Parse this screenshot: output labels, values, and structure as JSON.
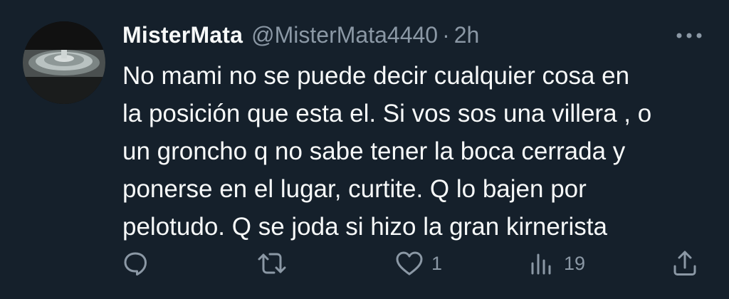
{
  "tweet": {
    "author": {
      "display_name": "MisterMata",
      "handle": "@MisterMata4440",
      "separator": "·",
      "time": "2h"
    },
    "text_lines": [
      "No mami  no se puede decir cualquier cosa en",
      "la posición que esta el. Si vos sos una villera , o",
      "un groncho q no sabe tener la boca cerrada y",
      "ponerse en el lugar, curtite. Q lo bajen por",
      "pelotudo. Q se joda si hizo la gran kirnerista"
    ],
    "actions": {
      "reply": {
        "icon": "reply-icon",
        "count": ""
      },
      "retweet": {
        "icon": "retweet-icon",
        "count": ""
      },
      "like": {
        "icon": "heart-icon",
        "count": "1"
      },
      "views": {
        "icon": "views-icon",
        "count": "19"
      },
      "share": {
        "icon": "share-icon",
        "count": ""
      }
    },
    "colors": {
      "background": "#15202b",
      "primary_text": "#f7f9f9",
      "secondary_text": "#8b98a5"
    }
  }
}
